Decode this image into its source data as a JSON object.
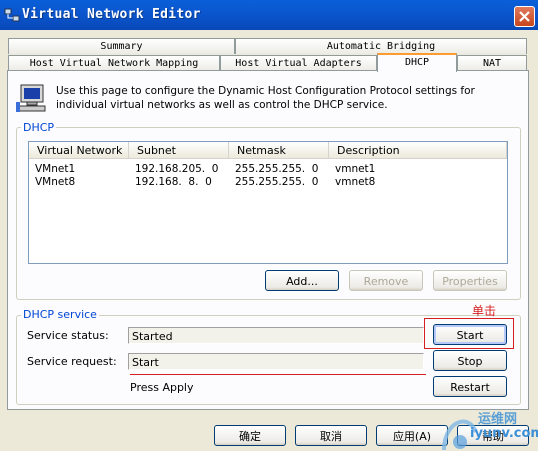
{
  "window": {
    "title": "Virtual Network Editor"
  },
  "tabs_row1": [
    {
      "label": "Summary"
    },
    {
      "label": "Automatic Bridging"
    }
  ],
  "tabs_row2": [
    {
      "label": "Host Virtual Network Mapping"
    },
    {
      "label": "Host Virtual Adapters"
    },
    {
      "label": "DHCP"
    },
    {
      "label": "NAT"
    }
  ],
  "active_tab": "DHCP",
  "info_text": "Use this page to configure the Dynamic Host Configuration Protocol settings for individual virtual networks as well as control the DHCP service.",
  "dhcp_group": {
    "label": "DHCP",
    "columns": [
      "Virtual Network",
      "Subnet",
      "Netmask",
      "Description"
    ],
    "rows": [
      [
        "VMnet1",
        "192.168.205.  0",
        "255.255.255.  0",
        "vmnet1"
      ],
      [
        "VMnet8",
        "192.168.  8.  0",
        "255.255.255.  0",
        "vmnet8"
      ]
    ],
    "add_label": "Add...",
    "remove_label": "Remove",
    "properties_label": "Properties"
  },
  "service_group": {
    "label": "DHCP service",
    "status_label": "Service status:",
    "status_value": "Started",
    "request_label": "Service request:",
    "request_value": "Start",
    "press_apply": "Press Apply",
    "start_label": "Start",
    "stop_label": "Stop",
    "restart_label": "Restart"
  },
  "annotation": "单击",
  "footer": {
    "ok_label": "确定",
    "cancel_label": "取消",
    "apply_label": "应用(A)",
    "help_label": "帮助"
  },
  "watermark": {
    "line1": "运维网",
    "line2": "iyunv.com"
  },
  "colors": {
    "titlebar": "#0b57d0",
    "tab_highlight": "#ff9a2e",
    "group_label": "#0046d5",
    "annotation": "#d62020"
  }
}
